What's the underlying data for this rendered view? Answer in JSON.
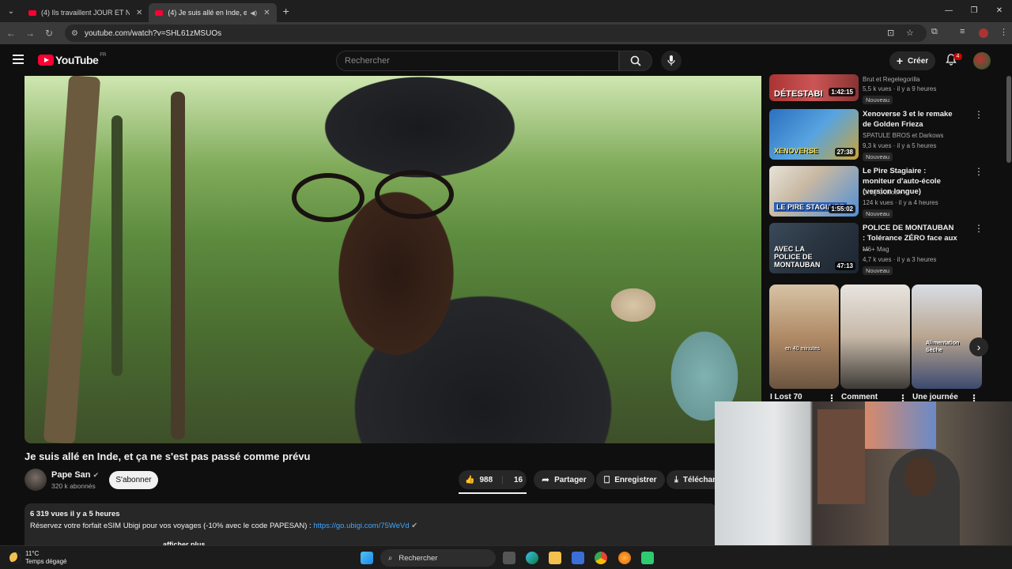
{
  "browser": {
    "tabs": [
      {
        "title": "(4) Ils travaillent JOUR ET NUIT"
      },
      {
        "title": "(4) Je suis allé en Inde, et ça"
      }
    ],
    "url": "youtube.com/watch?v=SHL61zMSUOs"
  },
  "header": {
    "logo_text": "YouTube",
    "country": "FR",
    "search_placeholder": "Rechercher",
    "create_label": "Créer",
    "notif_count": "4"
  },
  "player": {
    "title": "Je suis allé en Inde, et ça ne s'est pas passé comme prévu"
  },
  "channel": {
    "name": "Pape San",
    "subs": "320 k abonnés",
    "subscribe": "S'abonner"
  },
  "actions": {
    "likes": "988",
    "dislikes": "16",
    "share": "Partager",
    "save": "Enregistrer",
    "download": "Télécharger"
  },
  "description": {
    "meta": "6 319 vues  il y a 5 heures",
    "text": "Réservez votre forfait eSIM Ubigi pour vos voyages (-10% avec le code PAPESAN) : ",
    "link": "https://go.ubigi.com/75WeVd",
    "more": "afficher plus"
  },
  "sidebar": {
    "videos": [
      {
        "thumb_text": "DÉTESTABI",
        "duration": "1:42:15",
        "title": "",
        "channel": "Brut  et Regelegorilla",
        "views": "5,5 k vues · il y a 9 heures",
        "badge": "Nouveau"
      },
      {
        "thumb_text": "XENOVERSE",
        "duration": "27:38",
        "title": "Xenoverse 3 et le remake de Golden Frieza",
        "channel": "SPATULE BROS et Darkows",
        "views": "9,3 k vues · il y a 5 heures",
        "badge": "Nouveau"
      },
      {
        "thumb_text": "LE PIRE STAGIAIRE",
        "duration": "1:55:02",
        "title": "Le Pire Stagiaire : moniteur d'auto-école (version longue)",
        "channel": "Greg Guillotin",
        "views": "124 k vues · il y a 4 heures",
        "badge": "Nouveau"
      },
      {
        "thumb_text": "AVEC LA POLICE DE MONTAUBAN",
        "duration": "47:13",
        "title": "POLICE DE MONTAUBAN : Tolérance ZÉRO face aux ...",
        "channel": "M6+ Mag",
        "views": "4,7 k vues · il y a 3 heures",
        "badge": "Nouveau"
      }
    ],
    "shorts": [
      {
        "title": "I Lost 70",
        "overlay": "en 40 minutes"
      },
      {
        "title": "Comment",
        "overlay": ""
      },
      {
        "title": "Une journée",
        "overlay": "Alimentation Sèche"
      }
    ]
  },
  "taskbar": {
    "temp": "11°C",
    "weather": "Temps dégagé",
    "search": "Rechercher"
  }
}
